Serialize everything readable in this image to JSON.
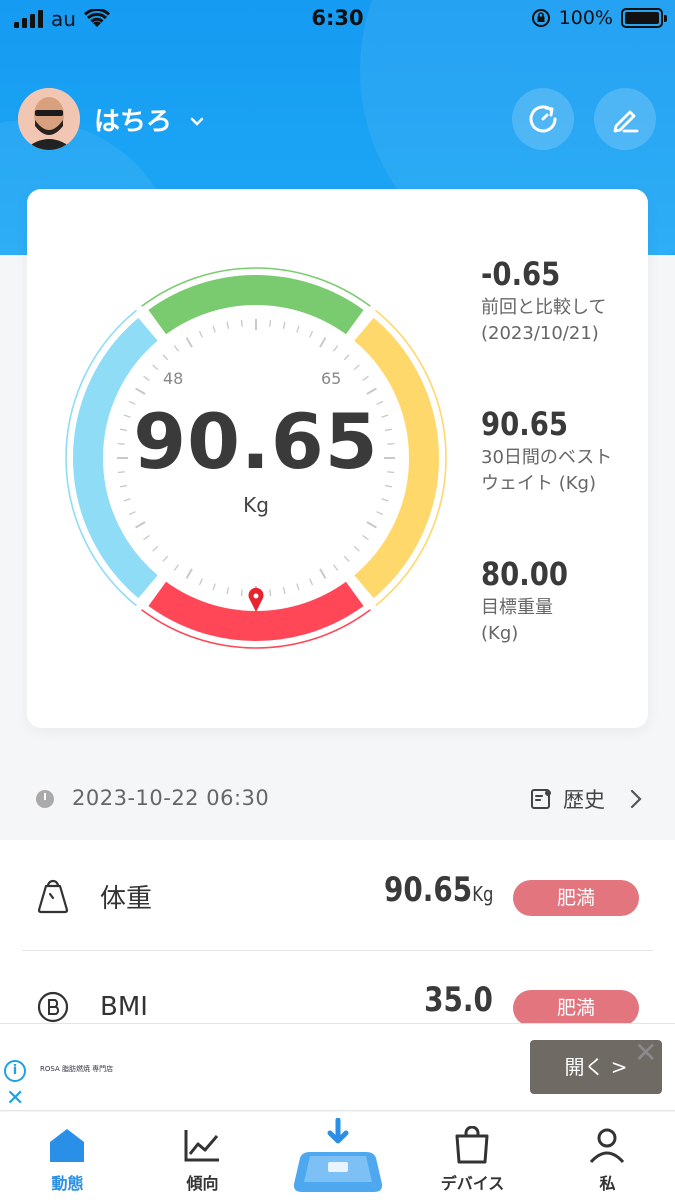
{
  "status_bar": {
    "carrier": "au",
    "time": "6:30",
    "battery_percent": "100%"
  },
  "profile": {
    "name": "はちろ"
  },
  "gauge": {
    "value": "90.65",
    "unit": "Kg",
    "range_labels": [
      "48",
      "65"
    ],
    "segments": [
      {
        "zone": "underweight",
        "color": "#8fdcf7"
      },
      {
        "zone": "normal",
        "color": "#7acb6f"
      },
      {
        "zone": "overweight",
        "color": "#ffd86b"
      },
      {
        "zone": "obese",
        "color": "#ff4757"
      }
    ],
    "marker_color": "#e8232e"
  },
  "stats": [
    {
      "value": "-0.65",
      "label_lines": [
        "前回と比較して",
        "(2023/10/21)"
      ]
    },
    {
      "value": "90.65",
      "label_lines": [
        "30日間のベスト",
        "ウェイト (Kg)"
      ]
    },
    {
      "value": "80.00",
      "label_lines": [
        "目標重量",
        "(Kg)"
      ]
    }
  ],
  "history": {
    "datetime": "2023-10-22 06:30",
    "link_label": "歴史"
  },
  "metrics": [
    {
      "label": "体重",
      "value": "90.65",
      "unit": "Kg",
      "status": "肥満"
    },
    {
      "label": "BMI",
      "value": "35.0",
      "unit": "",
      "status": "肥満"
    }
  ],
  "ad": {
    "info": "i",
    "text": "ROSA 脂肪燃焼 専門店",
    "open_label": "開く >"
  },
  "tabs": [
    {
      "label": "動態",
      "icon": "home-icon",
      "active": true
    },
    {
      "label": "傾向",
      "icon": "trend-icon",
      "active": false
    },
    {
      "label": "",
      "icon": "scale-icon",
      "active": false
    },
    {
      "label": "デバイス",
      "icon": "device-bag-icon",
      "active": false
    },
    {
      "label": "私",
      "icon": "person-icon",
      "active": false
    }
  ],
  "colors": {
    "brand_blue": "#1ea8f5",
    "badge_red": "#e2757e",
    "active_tab": "#2a8fe6"
  }
}
